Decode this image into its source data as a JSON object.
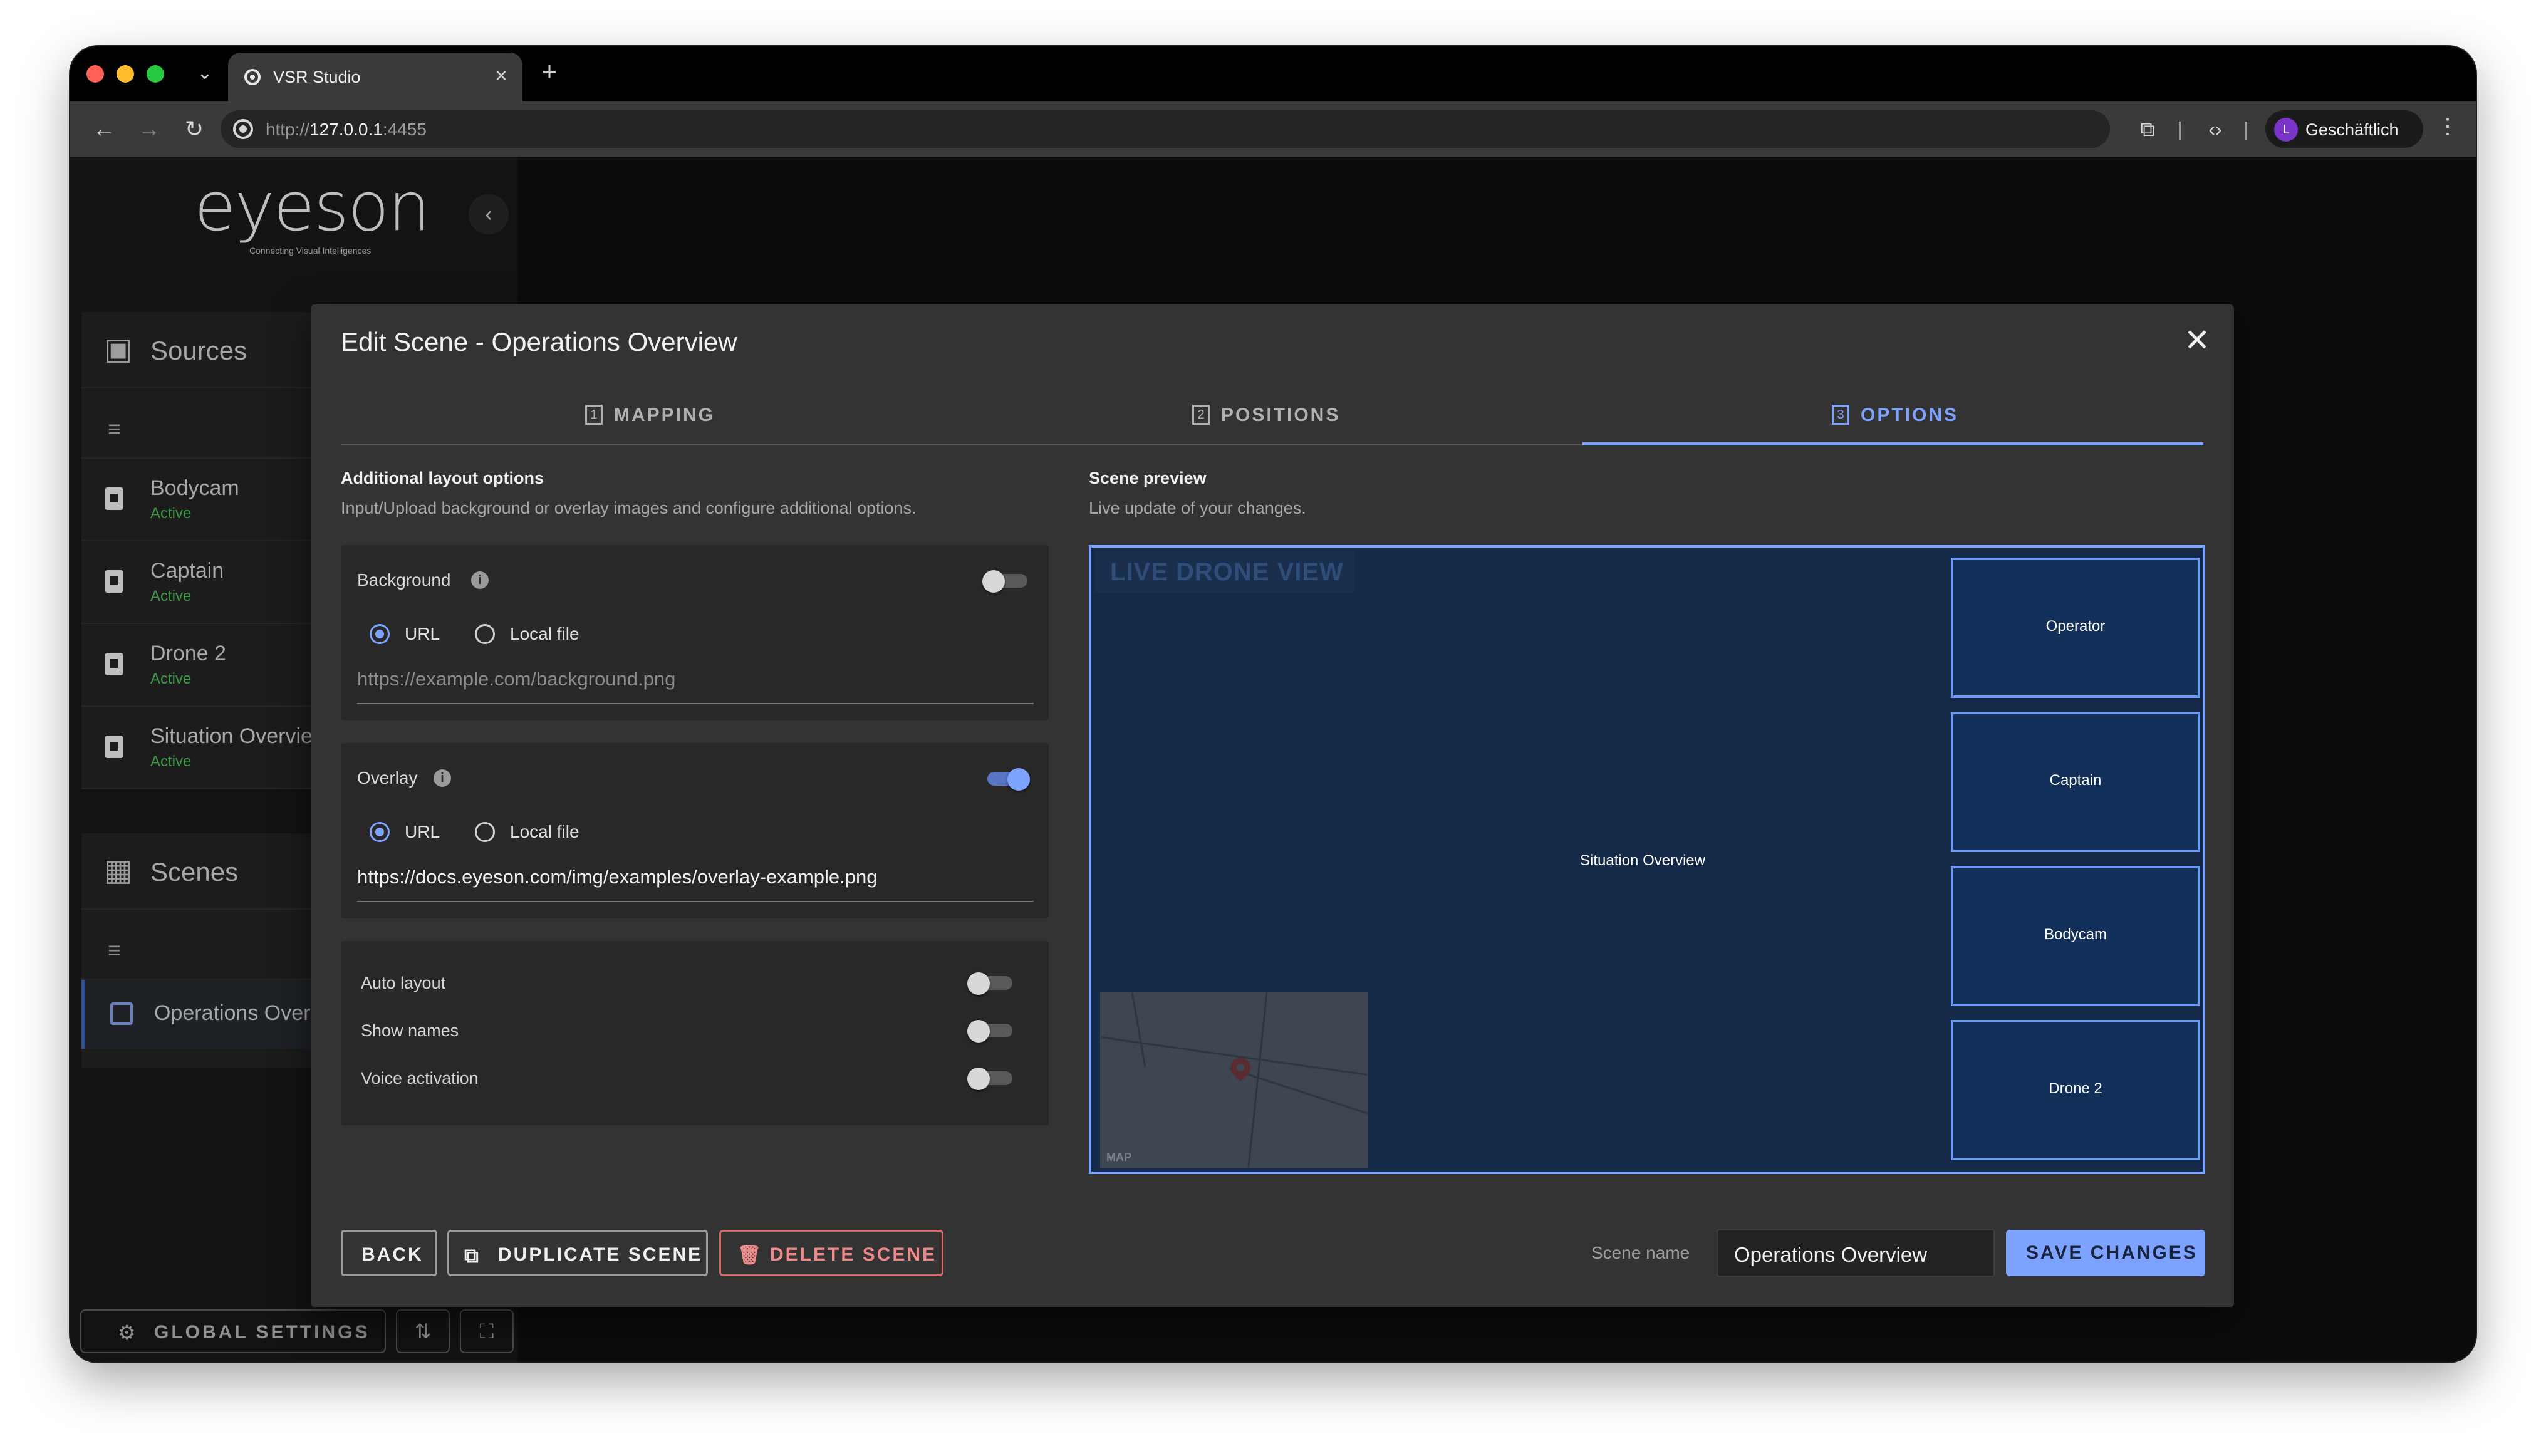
{
  "browser": {
    "tab_title": "VSR Studio",
    "url_prefix": "http://",
    "url_host": "127.0.0.1",
    "url_port": ":4455",
    "profile_initial": "L",
    "profile_label": "Geschäftlich"
  },
  "sidebar": {
    "logo": "eyeson",
    "logo_tagline": "Connecting Visual Intelligences",
    "sources": {
      "title": "Sources",
      "items": [
        {
          "name": "Bodycam",
          "status": "Active"
        },
        {
          "name": "Captain",
          "status": "Active"
        },
        {
          "name": "Drone 2",
          "status": "Active"
        },
        {
          "name": "Situation Overview",
          "status": "Active"
        }
      ]
    },
    "scenes": {
      "title": "Scenes",
      "items": [
        {
          "name": "Operations Overview"
        }
      ]
    },
    "global_settings": "GLOBAL SETTINGS"
  },
  "modal": {
    "title": "Edit Scene - Operations Overview",
    "tabs": [
      {
        "num": "1",
        "label": "MAPPING"
      },
      {
        "num": "2",
        "label": "POSITIONS"
      },
      {
        "num": "3",
        "label": "OPTIONS"
      }
    ],
    "active_tab": "OPTIONS",
    "left": {
      "title": "Additional layout options",
      "description": "Input/Upload background or overlay images and configure additional options.",
      "background": {
        "label": "Background",
        "enabled": false,
        "radio_url": "URL",
        "radio_local": "Local file",
        "selected": "URL",
        "placeholder": "https://example.com/background.png"
      },
      "overlay": {
        "label": "Overlay",
        "enabled": true,
        "radio_url": "URL",
        "radio_local": "Local file",
        "selected": "URL",
        "value": "https://docs.eyeson.com/img/examples/overlay-example.png"
      },
      "options": [
        {
          "label": "Auto layout",
          "enabled": false
        },
        {
          "label": "Show names",
          "enabled": false
        },
        {
          "label": "Voice activation",
          "enabled": false
        }
      ]
    },
    "right": {
      "title": "Scene preview",
      "description": "Live update of your changes.",
      "preview": {
        "overlay_text": "LIVE DRONE VIEW",
        "main": "Situation Overview",
        "tiles": [
          "Operator",
          "Captain",
          "Bodycam",
          "Drone 2"
        ],
        "map_label": "MAP"
      }
    },
    "footer": {
      "back": "BACK",
      "duplicate": "DUPLICATE SCENE",
      "delete": "DELETE SCENE",
      "scene_name_label": "Scene name",
      "scene_name_value": "Operations Overview",
      "save": "SAVE CHANGES"
    }
  },
  "colors": {
    "accent": "#7ea3ff",
    "danger": "#ef8a8a",
    "active_status": "#3e9b4a",
    "modal_bg": "#333333"
  }
}
